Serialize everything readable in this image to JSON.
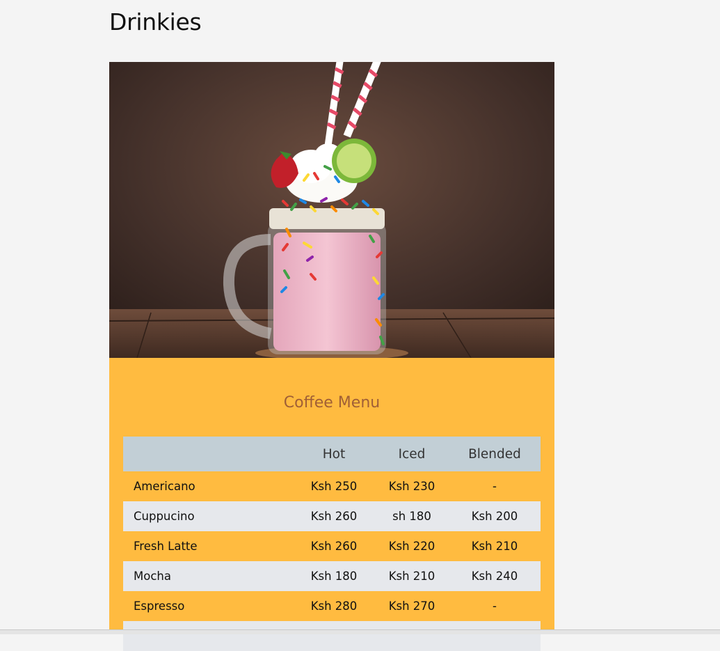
{
  "page": {
    "title": "Drinkies"
  },
  "hero": {
    "icon": "milkshake-photo"
  },
  "menu": {
    "title": "Coffee Menu",
    "columns": [
      "",
      "Hot",
      "Iced",
      "Blended"
    ],
    "rows": [
      {
        "name": "Americano",
        "hot": "Ksh 250",
        "iced": "Ksh 230",
        "blended": "-"
      },
      {
        "name": "Cuppucino",
        "hot": "Ksh 260",
        "iced": "sh 180",
        "blended": "Ksh 200"
      },
      {
        "name": "Fresh Latte",
        "hot": "Ksh 260",
        "iced": "Ksh 220",
        "blended": "Ksh 210"
      },
      {
        "name": "Mocha",
        "hot": "Ksh 180",
        "iced": "Ksh 210",
        "blended": "Ksh 240"
      },
      {
        "name": "Espresso",
        "hot": "Ksh 280",
        "iced": "Ksh 270",
        "blended": "-"
      },
      {
        "name": "",
        "hot": "",
        "iced": "",
        "blended": ""
      }
    ]
  },
  "colors": {
    "background": "#f4f4f4",
    "panel": "#ffbb40",
    "header_row": "#c2cfd6",
    "alt_row": "#e6e8ec",
    "menu_title": "#a05f36"
  }
}
